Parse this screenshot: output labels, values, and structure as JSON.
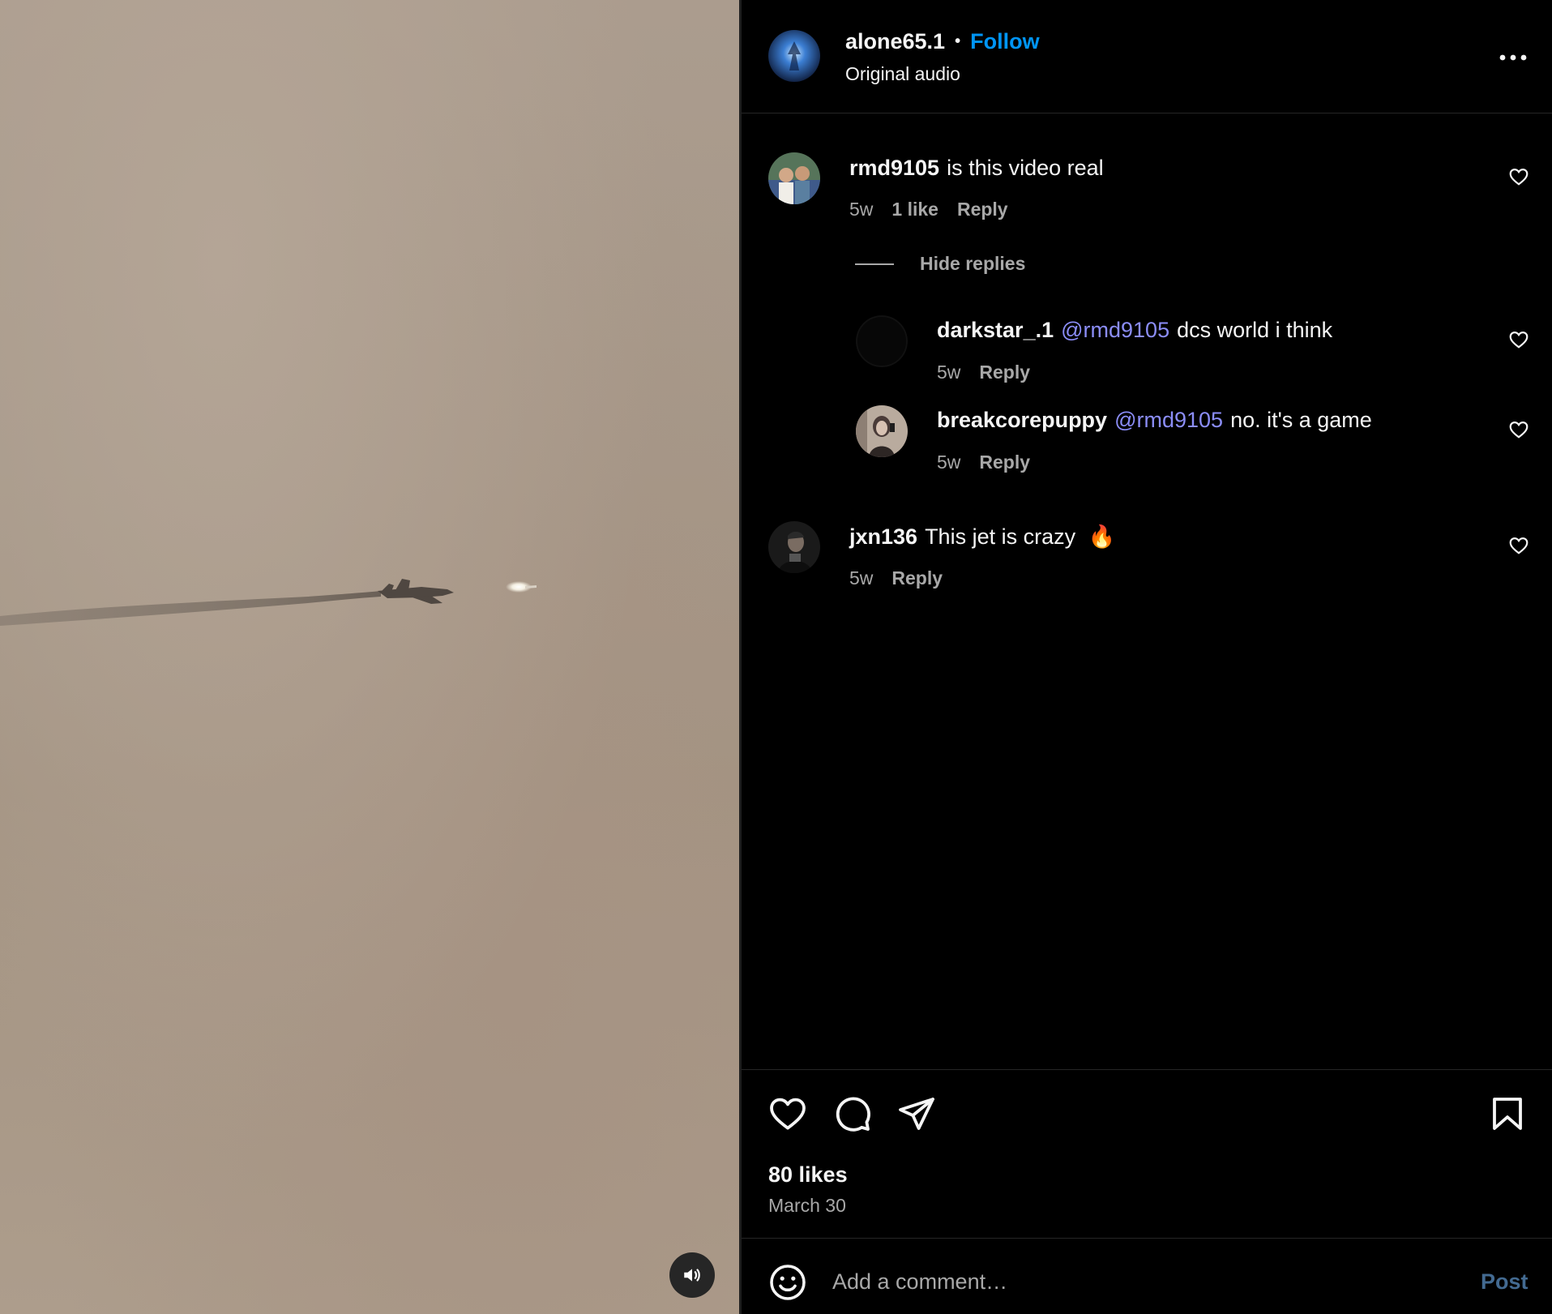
{
  "video": {
    "mute_icon": "speaker-icon"
  },
  "header": {
    "username": "alone65.1",
    "separator": "•",
    "follow_label": "Follow",
    "audio_label": "Original audio",
    "more_icon": "more-horizontal-icon"
  },
  "comments": [
    {
      "username": "rmd9105",
      "text": "is this video real",
      "time": "5w",
      "likes": "1 like",
      "reply_label": "Reply",
      "avatar_colors": [
        "#3b5a3a",
        "#6b8fa8"
      ]
    },
    {
      "username": "jxn136",
      "text": "This jet is crazy",
      "emoji": "🔥",
      "time": "5w",
      "reply_label": "Reply",
      "avatar_colors": [
        "#1c1c1c",
        "#6a6a6a"
      ]
    }
  ],
  "replies_toggle": "Hide replies",
  "replies": [
    {
      "username": "darkstar_.1",
      "mention": "@rmd9105",
      "text": "dcs world i think",
      "time": "5w",
      "reply_label": "Reply",
      "avatar_colors": [
        "#050505",
        "#0c0c0c"
      ]
    },
    {
      "username": "breakcorepuppy",
      "mention": "@rmd9105",
      "text": "no. it's a game",
      "time": "5w",
      "reply_label": "Reply",
      "avatar_colors": [
        "#c2b5a8",
        "#3a3230"
      ]
    }
  ],
  "actions": {
    "like_icon": "heart-icon",
    "comment_icon": "comment-bubble-icon",
    "share_icon": "paper-plane-icon",
    "save_icon": "bookmark-icon"
  },
  "likes_label": "80 likes",
  "date_label": "March 30",
  "composer": {
    "placeholder": "Add a comment…",
    "post_label": "Post",
    "emoji_icon": "smiley-icon"
  },
  "colors": {
    "accent": "#0095f6",
    "mention": "#8b8df7",
    "post_disabled": "#436a91",
    "muted_text": "#a8a8a8"
  }
}
